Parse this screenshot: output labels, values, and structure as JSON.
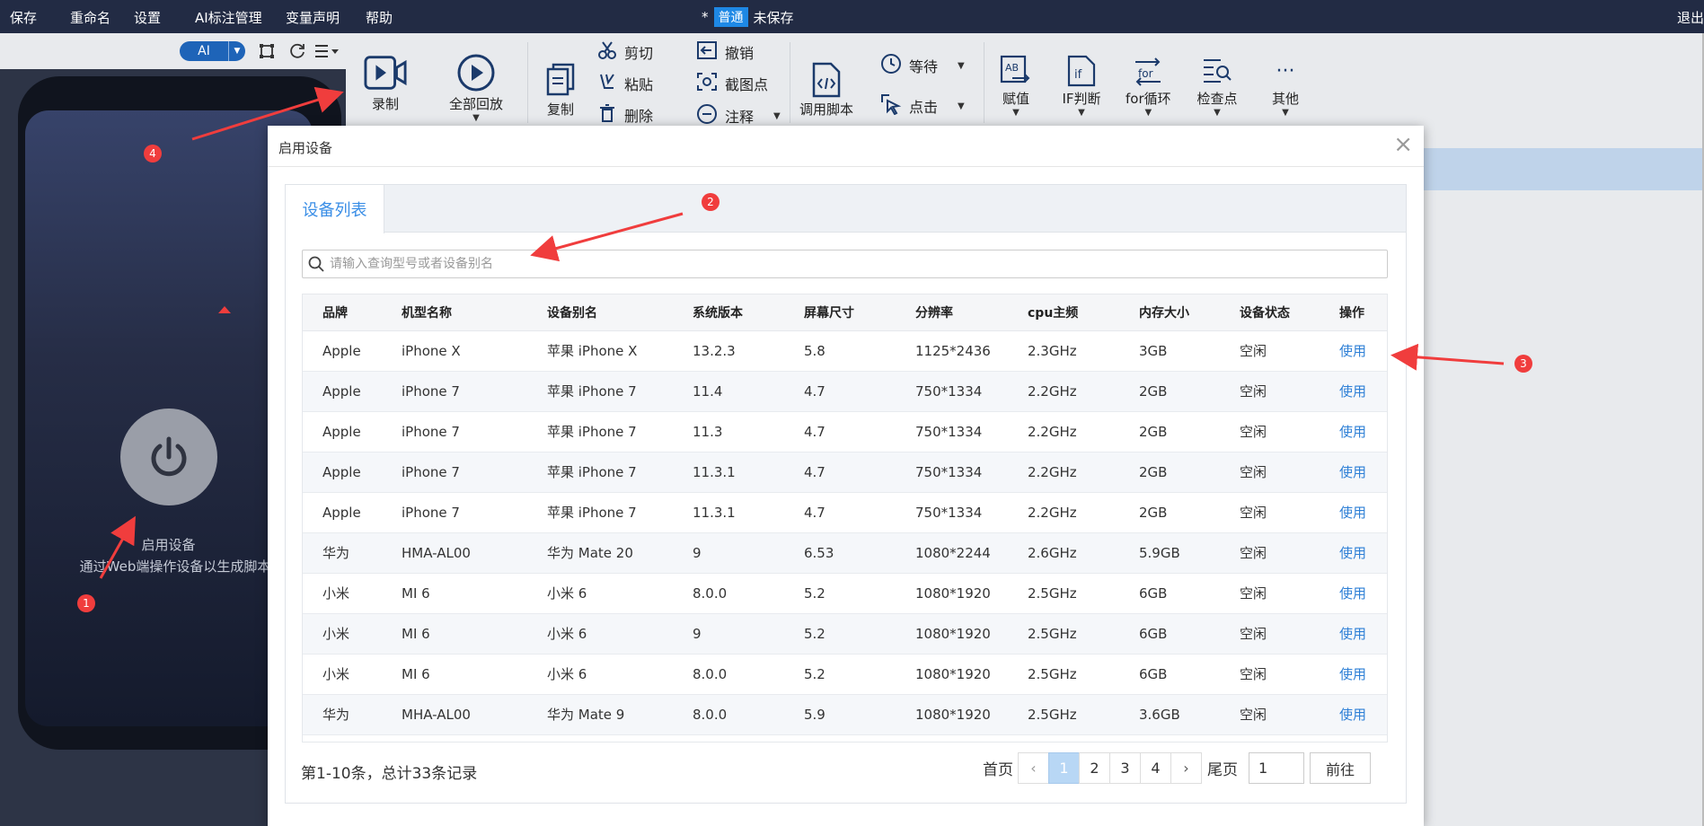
{
  "topbar": {
    "menu": [
      "保存",
      "重命名",
      "设置",
      "AI标注管理",
      "变量声明",
      "帮助"
    ],
    "unsaved_mark": "*",
    "mode": "普通",
    "save_state": "未保存",
    "logout": "退出"
  },
  "left": {
    "ai_label": "AI",
    "start_title": "启用设备",
    "start_desc": "通过Web端操作设备以生成脚本"
  },
  "ribbon": {
    "record": "录制",
    "replay_all": "全部回放",
    "copy": "复制",
    "cut": "剪切",
    "paste": "粘贴",
    "delete": "删除",
    "undo": "撤销",
    "screenshot": "截图点",
    "comment": "注释",
    "call_script": "调用脚本",
    "wait": "等待",
    "click": "点击",
    "assign": "赋值",
    "if": "IF判断",
    "for": "for循环",
    "checkpoint": "检查点",
    "more": "其他"
  },
  "modal": {
    "title": "启用设备",
    "tab": "设备列表",
    "search_placeholder": "请输入查询型号或者设备别名",
    "columns": [
      "品牌",
      "机型名称",
      "设备别名",
      "系统版本",
      "屏幕尺寸",
      "分辨率",
      "cpu主频",
      "内存大小",
      "设备状态",
      "操作"
    ],
    "rows": [
      [
        "Apple",
        "iPhone X",
        "苹果 iPhone X",
        "13.2.3",
        "5.8",
        "1125*2436",
        "2.3GHz",
        "3GB",
        "空闲",
        "使用"
      ],
      [
        "Apple",
        "iPhone 7",
        "苹果 iPhone 7",
        "11.4",
        "4.7",
        "750*1334",
        "2.2GHz",
        "2GB",
        "空闲",
        "使用"
      ],
      [
        "Apple",
        "iPhone 7",
        "苹果 iPhone 7",
        "11.3",
        "4.7",
        "750*1334",
        "2.2GHz",
        "2GB",
        "空闲",
        "使用"
      ],
      [
        "Apple",
        "iPhone 7",
        "苹果 iPhone 7",
        "11.3.1",
        "4.7",
        "750*1334",
        "2.2GHz",
        "2GB",
        "空闲",
        "使用"
      ],
      [
        "Apple",
        "iPhone 7",
        "苹果 iPhone 7",
        "11.3.1",
        "4.7",
        "750*1334",
        "2.2GHz",
        "2GB",
        "空闲",
        "使用"
      ],
      [
        "华为",
        "HMA-AL00",
        "华为 Mate 20",
        "9",
        "6.53",
        "1080*2244",
        "2.6GHz",
        "5.9GB",
        "空闲",
        "使用"
      ],
      [
        "小米",
        "MI 6",
        "小米 6",
        "8.0.0",
        "5.2",
        "1080*1920",
        "2.5GHz",
        "6GB",
        "空闲",
        "使用"
      ],
      [
        "小米",
        "MI 6",
        "小米 6",
        "9",
        "5.2",
        "1080*1920",
        "2.5GHz",
        "6GB",
        "空闲",
        "使用"
      ],
      [
        "小米",
        "MI 6",
        "小米 6",
        "8.0.0",
        "5.2",
        "1080*1920",
        "2.5GHz",
        "6GB",
        "空闲",
        "使用"
      ],
      [
        "华为",
        "MHA-AL00",
        "华为 Mate 9",
        "8.0.0",
        "5.9",
        "1080*1920",
        "2.5GHz",
        "3.6GB",
        "空闲",
        "使用"
      ]
    ],
    "pager_info": "第1-10条，总计33条记录",
    "first": "首页",
    "last": "尾页",
    "pages": [
      "1",
      "2",
      "3",
      "4"
    ],
    "current_page": "1",
    "jump_value": "1",
    "go": "前往"
  },
  "annotations": [
    "1",
    "2",
    "3",
    "4"
  ],
  "colors": {
    "accent": "#3a8ee6",
    "link": "#2d7fd6",
    "topbar": "#222b44",
    "marker": "#f03d3d"
  }
}
